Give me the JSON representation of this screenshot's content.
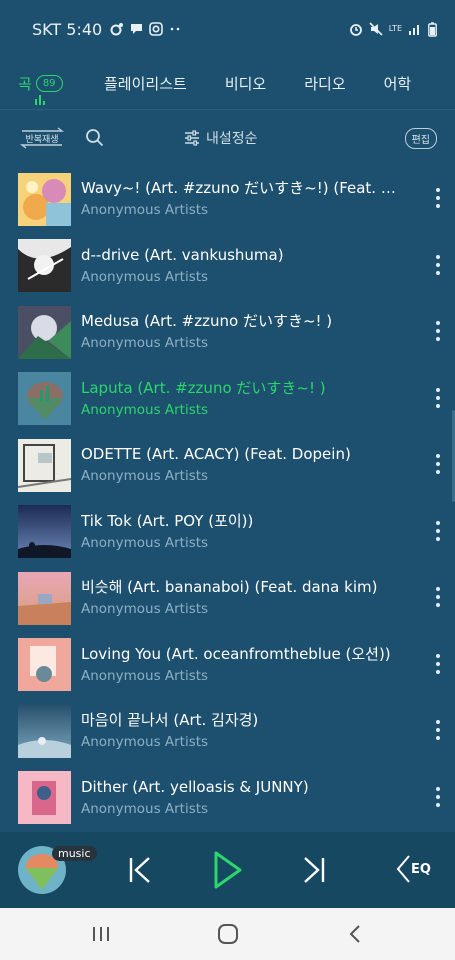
{
  "status_bar": {
    "carrier_time": "SKT 5:40",
    "left_icons": [
      "notification-icon",
      "chat-icon",
      "instagram-icon",
      "more-dots-icon"
    ],
    "right_icons": [
      "alarm-icon",
      "mute-icon",
      "lte-icon",
      "signal-icon",
      "battery-icon"
    ],
    "lte_label": "LTE"
  },
  "tabs": {
    "song": "곡",
    "song_count": "89",
    "playlist": "플레이리스트",
    "video": "비디오",
    "radio": "라디오",
    "language": "어학",
    "active_color": "#2bd66b"
  },
  "toolbar": {
    "repeat_label": "반복재생",
    "sort_label": "내설정순",
    "edit_label": "편집"
  },
  "songs": [
    {
      "title": "Wavy~! (Art. #zzuno だいすき~!) (Feat. T…",
      "artist": "Anonymous Artists",
      "active": false
    },
    {
      "title": "d--drive (Art. vankushuma)",
      "artist": "Anonymous Artists",
      "active": false
    },
    {
      "title": "Medusa (Art. #zzuno だいすき~! )",
      "artist": "Anonymous Artists",
      "active": false
    },
    {
      "title": "Laputa (Art. #zzuno だいすき~! )",
      "artist": "Anonymous Artists",
      "active": true
    },
    {
      "title": "ODETTE (Art. ACACY) (Feat. Dopein)",
      "artist": "Anonymous Artists",
      "active": false
    },
    {
      "title": "Tik Tok (Art. POY (포이))",
      "artist": "Anonymous Artists",
      "active": false
    },
    {
      "title": "비슷해 (Art. bananaboi) (Feat. dana kim)",
      "artist": "Anonymous Artists",
      "active": false
    },
    {
      "title": "Loving You (Art. oceanfromtheblue (오션))",
      "artist": "Anonymous Artists",
      "active": false
    },
    {
      "title": "마음이 끝나서 (Art. 김자경)",
      "artist": "Anonymous Artists",
      "active": false
    },
    {
      "title": "Dither (Art. yelloasis & JUNNY)",
      "artist": "Anonymous Artists",
      "active": false
    }
  ],
  "player": {
    "badge": "music",
    "eq_label": "EQ",
    "controls": [
      "previous-icon",
      "play-icon",
      "next-icon",
      "equalizer-icon"
    ]
  },
  "nav_bar": {
    "buttons": [
      "recent-apps-icon",
      "home-icon",
      "back-icon"
    ]
  }
}
